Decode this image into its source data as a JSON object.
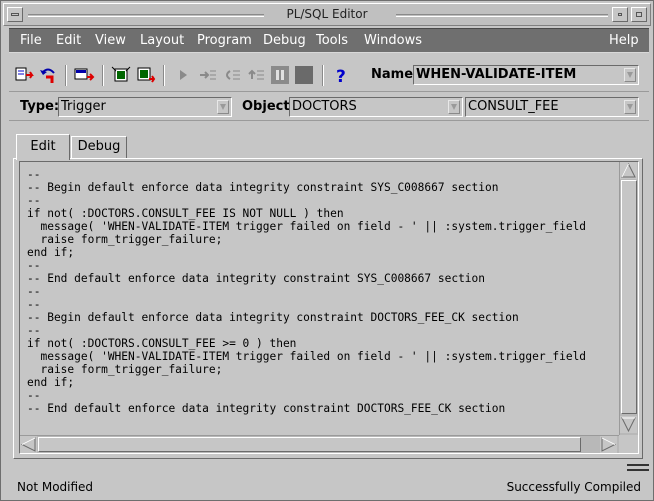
{
  "window": {
    "title": "PL/SQL Editor"
  },
  "menu": {
    "items": [
      {
        "label": "File"
      },
      {
        "label": "Edit"
      },
      {
        "label": "View"
      },
      {
        "label": "Layout"
      },
      {
        "label": "Program"
      },
      {
        "label": "Debug"
      },
      {
        "label": "Tools"
      },
      {
        "label": "Windows"
      },
      {
        "label": "Help"
      }
    ]
  },
  "toolbar": {
    "name_label": "Name:",
    "name_value": "WHEN-VALIDATE-ITEM",
    "icons": [
      "compile-icon",
      "revert-icon",
      "new-icon",
      "delete-icon",
      "settings-icon",
      "go-icon",
      "step-into-icon",
      "step-over-icon",
      "step-out-icon",
      "pause-icon",
      "stop-icon",
      "help-icon"
    ]
  },
  "object_row": {
    "type_label": "Type:",
    "type_value": "Trigger",
    "object_label": "Object:",
    "object_value": "DOCTORS",
    "item_value": "CONSULT_FEE"
  },
  "tabs": [
    {
      "label": "Edit",
      "active": true
    },
    {
      "label": "Debug",
      "active": false
    }
  ],
  "code_lines": [
    "--",
    "-- Begin default enforce data integrity constraint SYS_C008667 section",
    "--",
    "if not( :DOCTORS.CONSULT_FEE IS NOT NULL ) then",
    "  message( 'WHEN-VALIDATE-ITEM trigger failed on field - ' || :system.trigger_field",
    "  raise form_trigger_failure;",
    "end if;",
    "--",
    "-- End default enforce data integrity constraint SYS_C008667 section",
    "--",
    "--",
    "-- Begin default enforce data integrity constraint DOCTORS_FEE_CK section",
    "--",
    "if not( :DOCTORS.CONSULT_FEE >= 0 ) then",
    "  message( 'WHEN-VALIDATE-ITEM trigger failed on field - ' || :system.trigger_field",
    "  raise form_trigger_failure;",
    "end if;",
    "--",
    "-- End default enforce data integrity constraint DOCTORS_FEE_CK section"
  ],
  "status": {
    "left": "Not Modified",
    "right": "Successfully Compiled"
  },
  "colors": {
    "menubar_bg": "#6f6f6f",
    "window_bg": "#c6c6c6"
  }
}
